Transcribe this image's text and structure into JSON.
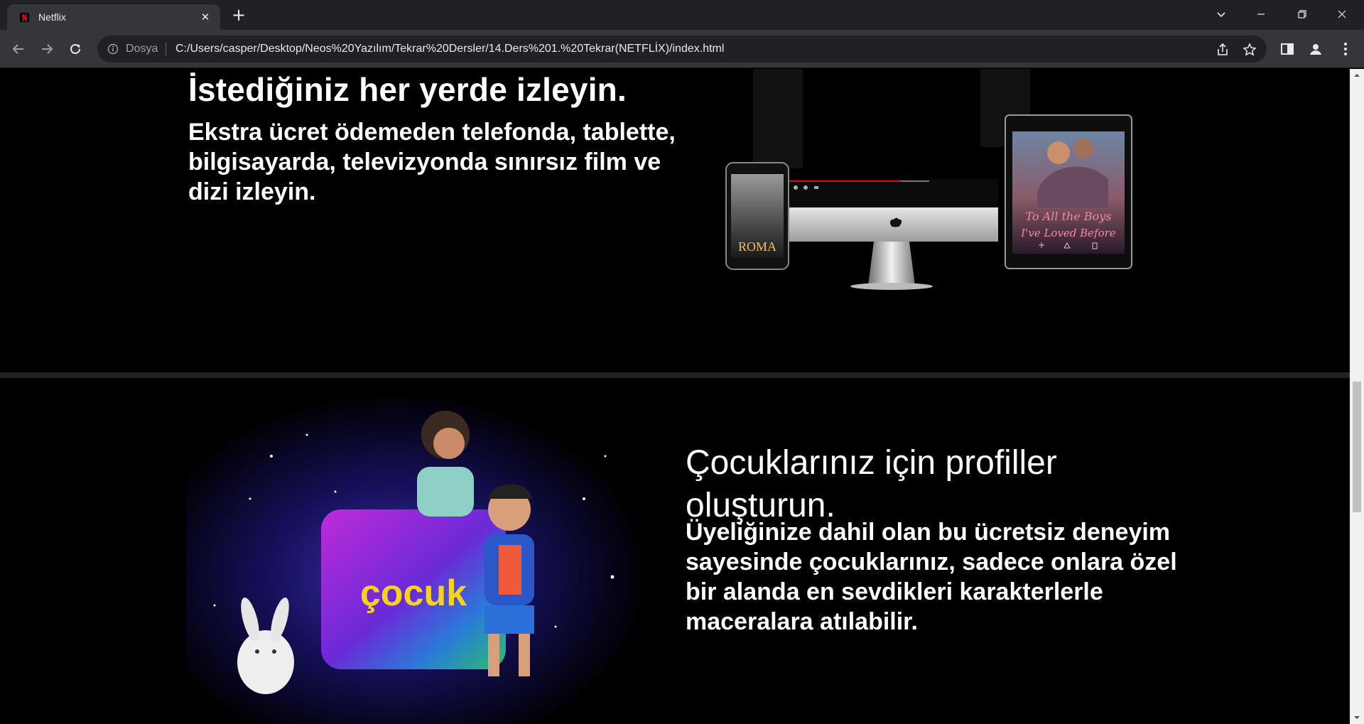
{
  "browser": {
    "tab": {
      "title": "Netflix",
      "close": "✕"
    },
    "new_tab": "+",
    "omnibox": {
      "scheme_label": "Dosya",
      "url": "C:/Users/casper/Desktop/Neos%20Yazılım/Tekrar%20Dersler/14.Ders%201.%20Tekrar(NETFLİX)/index.html"
    },
    "icons": [
      "back-icon",
      "forward-icon",
      "reload-icon",
      "info-icon",
      "share-icon",
      "star-icon",
      "side-panel-icon",
      "profile-icon",
      "menu-icon",
      "tab-search-icon",
      "minimize-icon",
      "restore-icon",
      "close-icon"
    ]
  },
  "section_devices": {
    "title": "İstediğiniz her yerde izleyin.",
    "text": "Ekstra ücret ödemeden telefonda, tablette, bilgisayarda, televizyonda sınırsız film ve dizi izleyin.",
    "phone_poster": "ROMA",
    "tablet_poster_line1": "To All the Boys",
    "tablet_poster_line2": "I've Loved Before"
  },
  "section_kids": {
    "title": "Çocuklarınız için profiller oluşturun.",
    "text": "Üyeliğinize dahil olan bu ücretsiz deneyim sayesinde çocuklarınız, sadece onlara özel bir alanda en sevdikleri karakterlerle maceralara atılabilir.",
    "badge": "çocuk"
  },
  "colors": {
    "netflix_red": "#e50914",
    "chrome_dark": "#202124",
    "chrome_toolbar": "#35363a"
  }
}
